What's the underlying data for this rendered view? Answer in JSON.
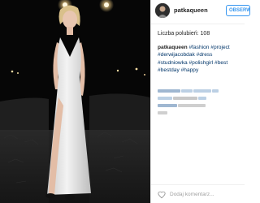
{
  "post": {
    "username": "patkaqueen",
    "follow_label": "OBSERWUJ",
    "likes_text": "Liczba polubień: 108",
    "caption": {
      "user": "patkaqueen",
      "hashtags": [
        "#fashion",
        "#project",
        "#derwijacobdak",
        "#dress",
        "#studniowka",
        "#polishgirl",
        "#best",
        "#bestday",
        "#happy"
      ]
    },
    "comment_placeholder": "Dodaj komentarz..."
  },
  "icons": {
    "avatar": "avatar-photo",
    "like": "heart-outline-icon"
  },
  "colors": {
    "link": "#003569",
    "follow": "#3897f0",
    "text": "#262626"
  }
}
